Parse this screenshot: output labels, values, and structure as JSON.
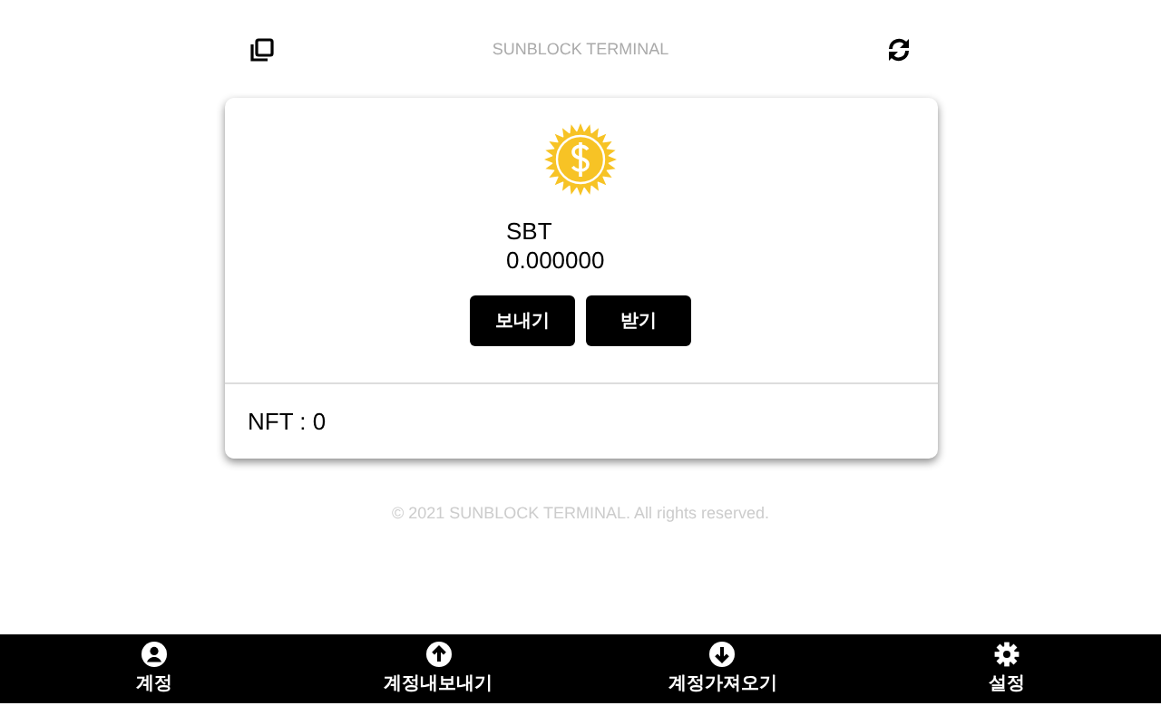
{
  "header": {
    "title": "SUNBLOCK TERMINAL"
  },
  "wallet": {
    "token": "SBT",
    "balance": "0.000000",
    "buttons": [
      "보내기",
      "받기"
    ],
    "nft": "NFT : 0"
  },
  "footer": "© 2021 SUNBLOCK TERMINAL. All rights reserved.",
  "bottom_nav": [
    {
      "kind": "account",
      "label": "계정"
    },
    {
      "kind": "export",
      "label": "계정내보내기"
    },
    {
      "kind": "import",
      "label": "계정가져오기"
    },
    {
      "kind": "settings",
      "label": "설정"
    }
  ]
}
